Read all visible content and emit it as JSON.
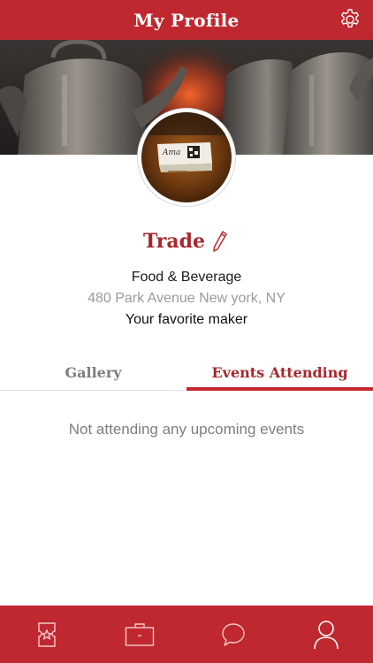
{
  "header": {
    "title": "My Profile"
  },
  "profile": {
    "name": "Trade",
    "category": "Food & Beverage",
    "address": "480 Park Avenue New york, NY",
    "tagline": "Your favorite maker"
  },
  "tabs": [
    {
      "label": "Gallery",
      "active": false
    },
    {
      "label": "Events Attending",
      "active": true
    }
  ],
  "events": {
    "empty_message": "Not attending any upcoming events"
  },
  "bottom_nav": [
    {
      "icon": "ticket-icon",
      "active": false
    },
    {
      "icon": "briefcase-icon",
      "active": false
    },
    {
      "icon": "chat-bubble-icon",
      "active": false
    },
    {
      "icon": "user-icon",
      "active": true
    }
  ],
  "colors": {
    "brand_red": "#c0282f",
    "name_red": "#a6282d",
    "inactive_tab": "#7d7d7d",
    "muted_text": "#9a9a9a"
  }
}
